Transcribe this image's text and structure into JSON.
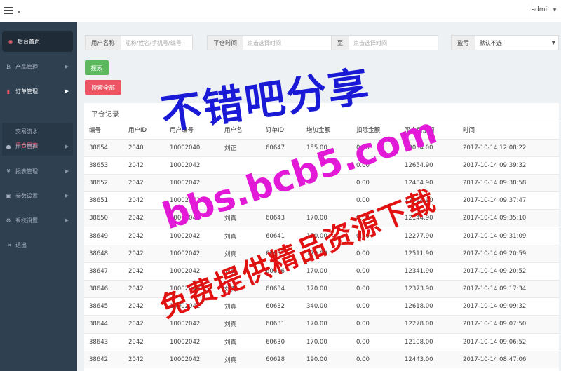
{
  "header": {
    "user": "admin"
  },
  "sidebar": {
    "items": [
      {
        "label": "后台首页",
        "icon": "dashboard-icon"
      },
      {
        "label": "产品管理",
        "icon": "bitcoin-icon"
      },
      {
        "label": "订单管理",
        "icon": "file-icon"
      },
      {
        "label": "用户管理",
        "icon": "user-icon"
      },
      {
        "label": "报表管理",
        "icon": "yen-icon"
      },
      {
        "label": "参数设置",
        "icon": "copy-icon"
      },
      {
        "label": "系统设置",
        "icon": "gears-icon"
      },
      {
        "label": "退出",
        "icon": "signout-icon"
      }
    ],
    "submenu": [
      {
        "label": "交易流水"
      },
      {
        "label": "平仓日志"
      }
    ]
  },
  "filters": {
    "user_label": "用户名称",
    "user_placeholder": "昵称/姓名/手机号/编号",
    "time_label": "平仓时间",
    "time_start_placeholder": "点击选择时间",
    "time_sep": "至",
    "time_end_placeholder": "点击选择时间",
    "pnl_label": "盈亏",
    "pnl_value": "默认不选"
  },
  "buttons": {
    "search": "搜索",
    "search_all": "搜索全部"
  },
  "panel": {
    "title": "平仓记录",
    "columns": [
      "编号",
      "用户ID",
      "用户编号",
      "用户名",
      "订单ID",
      "增加金额",
      "扣除金额",
      "平仓后余额",
      "时间"
    ],
    "rows": [
      [
        "38654",
        "2040",
        "10002040",
        "刘正",
        "60647",
        "155.00",
        "0.00",
        "10054.00",
        "2017-10-14 12:08:22"
      ],
      [
        "38653",
        "2042",
        "10002042",
        "",
        "",
        "",
        "0.00",
        "12654.90",
        "2017-10-14 09:39:32"
      ],
      [
        "38652",
        "2042",
        "10002042",
        "",
        "",
        "",
        "0.00",
        "12484.90",
        "2017-10-14 09:38:58"
      ],
      [
        "38651",
        "2042",
        "10002042",
        "",
        "",
        "",
        "0.00",
        "12314.90",
        "2017-10-14 09:37:47"
      ],
      [
        "38650",
        "2042",
        "10002042",
        "刘真",
        "60643",
        "170.00",
        "0.00",
        "12144.90",
        "2017-10-14 09:35:10"
      ],
      [
        "38649",
        "2042",
        "10002042",
        "刘真",
        "60641",
        "170.00",
        "0.00",
        "12277.90",
        "2017-10-14 09:31:09"
      ],
      [
        "38648",
        "2042",
        "10002042",
        "刘真",
        "60637",
        "170.00",
        "0.00",
        "12511.90",
        "2017-10-14 09:20:59"
      ],
      [
        "38647",
        "2042",
        "10002042",
        "刘真",
        "60636",
        "170.00",
        "0.00",
        "12341.90",
        "2017-10-14 09:20:52"
      ],
      [
        "38646",
        "2042",
        "10002042",
        "刘真",
        "60634",
        "170.00",
        "0.00",
        "12373.90",
        "2017-10-14 09:17:34"
      ],
      [
        "38645",
        "2042",
        "10002042",
        "刘真",
        "60632",
        "340.00",
        "0.00",
        "12618.00",
        "2017-10-14 09:09:32"
      ],
      [
        "38644",
        "2042",
        "10002042",
        "刘真",
        "60631",
        "170.00",
        "0.00",
        "12278.00",
        "2017-10-14 09:07:50"
      ],
      [
        "38643",
        "2042",
        "10002042",
        "刘真",
        "60630",
        "170.00",
        "0.00",
        "12108.00",
        "2017-10-14 09:06:52"
      ],
      [
        "38642",
        "2042",
        "10002042",
        "刘真",
        "60628",
        "190.00",
        "0.00",
        "12443.00",
        "2017-10-14 08:47:06"
      ]
    ]
  },
  "watermark": {
    "line1": "不错吧分享",
    "line2": "bbs.bcb5.com",
    "line3": "免费提供精品资源下载"
  },
  "colors": {
    "accent_red": "#ed5565",
    "search_green": "#5cb85c",
    "sidebar_bg": "#2f4050"
  }
}
